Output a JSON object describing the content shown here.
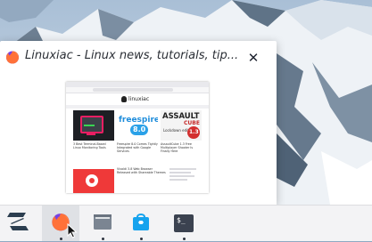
{
  "preview": {
    "title": "Linuxiac - Linux news, tutorials, tip...",
    "favicon": "firefox-icon",
    "close_icon": "close-icon",
    "thumbnail": {
      "site_logo": "linuxiac",
      "articles": [
        {
          "caption": "3 Best Terminal-Based Linux Monitoring Tools"
        },
        {
          "caption": "Freespire 8.0 Comes Tightly Integrated with Google Services",
          "banner": "freespire",
          "banner_version": "8.0"
        },
        {
          "caption": "AssaultCube 1.3 Free Multiplayer Shooter Is Finally Here",
          "banner": "ASSAULT",
          "banner_sub": "CUBE",
          "banner_version": "1.3",
          "banner_note": "Lockdown edition"
        },
        {
          "caption": "Vivaldi 3.8 Web Browser Released with Shareable Themes"
        }
      ]
    }
  },
  "taskbar": {
    "items": [
      {
        "name": "zorin-menu",
        "icon": "zorin-logo-icon",
        "running": false
      },
      {
        "name": "firefox",
        "icon": "firefox-icon",
        "running": true,
        "active": true
      },
      {
        "name": "files",
        "icon": "folder-icon",
        "running": true
      },
      {
        "name": "software",
        "icon": "software-store-icon",
        "running": true
      },
      {
        "name": "terminal",
        "icon": "terminal-icon",
        "running": true,
        "label": "$_"
      }
    ]
  },
  "colors": {
    "taskbar_bg": "#f3f3f5",
    "active_item_bg": "#dfe1e5",
    "firefox_orange": "#ff7139",
    "accent_blue": "#1f8ddb"
  }
}
